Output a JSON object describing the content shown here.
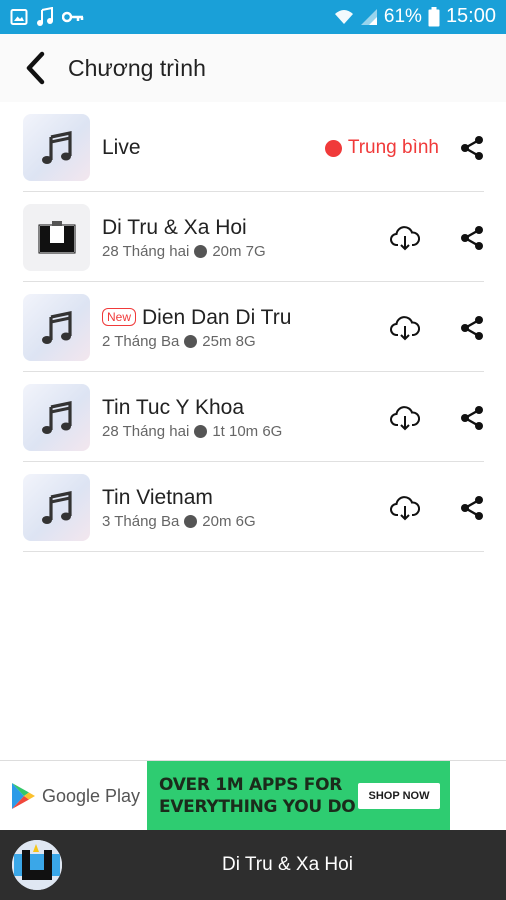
{
  "status_bar": {
    "battery_percent": "61%",
    "time": "15:00"
  },
  "app_bar": {
    "title": "Chương trình"
  },
  "list": {
    "items": [
      {
        "title": "Live",
        "status_label": "Trung bình",
        "status_color": "#f03a3a",
        "icon": "music-note-icon"
      },
      {
        "title": "Di Tru & Xa Hoi",
        "date": "28 Tháng hai",
        "duration": "20m 7G",
        "icon": "program-logo-icon"
      },
      {
        "badge": "New",
        "title": "Dien Dan Di Tru",
        "date": "2 Tháng Ba",
        "duration": "25m 8G",
        "icon": "music-note-icon"
      },
      {
        "title": "Tin Tuc Y Khoa",
        "date": "28 Tháng hai",
        "duration": "1t 10m 6G",
        "icon": "music-note-icon"
      },
      {
        "title": "Tin Vietnam",
        "date": "3 Tháng Ba",
        "duration": "20m 6G",
        "icon": "music-note-icon"
      }
    ]
  },
  "ad": {
    "store_name": "Google Play",
    "headline_line1": "OVER 1M APPS FOR",
    "headline_line2": "EVERYTHING YOU DO",
    "cta": "SHOP NOW",
    "accent_color": "#2ecc71"
  },
  "player": {
    "now_playing": "Di Tru & Xa Hoi"
  },
  "colors": {
    "status_bar": "#1aa0d8",
    "live_red": "#f03a3a",
    "player_bg": "#2e2e2e"
  }
}
